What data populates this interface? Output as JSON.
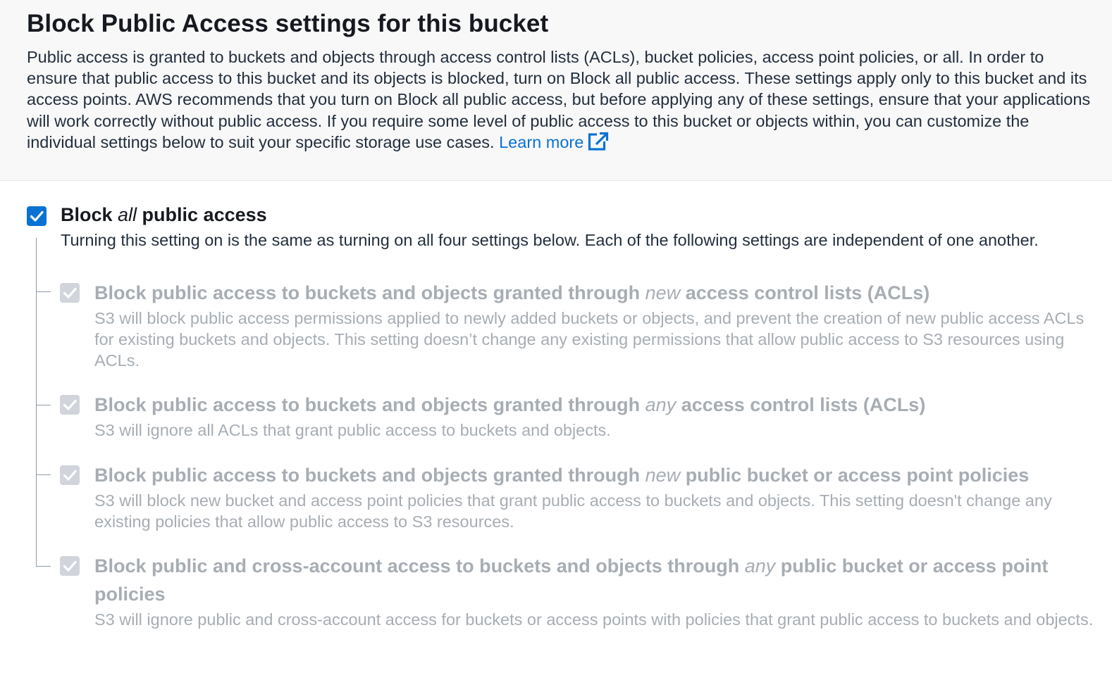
{
  "header": {
    "title": "Block Public Access settings for this bucket",
    "description": "Public access is granted to buckets and objects through access control lists (ACLs), bucket policies, access point policies, or all. In order to ensure that public access to this bucket and its objects is blocked, turn on Block all public access. These settings apply only to this bucket and its access points. AWS recommends that you turn on Block all public access, but before applying any of these settings, ensure that your applications will work correctly without public access. If you require some level of public access to this bucket or objects within, you can customize the individual settings below to suit your specific storage use cases.",
    "learn_more": "Learn more",
    "learn_more_icon": "external-link-icon"
  },
  "block_all": {
    "checked": true,
    "label_before": "Block ",
    "label_em": "all",
    "label_after": " public access",
    "description": "Turning this setting on is the same as turning on all four settings below. Each of the following settings are independent of one another."
  },
  "options": [
    {
      "checked": true,
      "disabled": true,
      "label_before": "Block public access to buckets and objects granted through ",
      "label_em": "new",
      "label_after": " access control lists (ACLs)",
      "description": "S3 will block public access permissions applied to newly added buckets or objects, and prevent the creation of new public access ACLs for existing buckets and objects. This setting doesn’t change any existing permissions that allow public access to S3 resources using ACLs."
    },
    {
      "checked": true,
      "disabled": true,
      "label_before": "Block public access to buckets and objects granted through ",
      "label_em": "any",
      "label_after": " access control lists (ACLs)",
      "description": "S3 will ignore all ACLs that grant public access to buckets and objects."
    },
    {
      "checked": true,
      "disabled": true,
      "label_before": "Block public access to buckets and objects granted through ",
      "label_em": "new",
      "label_after": " public bucket or access point policies",
      "description": "S3 will block new bucket and access point policies that grant public access to buckets and objects. This setting doesn't change any existing policies that allow public access to S3 resources."
    },
    {
      "checked": true,
      "disabled": true,
      "label_before": "Block public and cross-account access to buckets and objects through ",
      "label_em": "any",
      "label_after": " public bucket or access point policies",
      "description": "S3 will ignore public and cross-account access for buckets or access points with policies that grant public access to buckets and objects."
    }
  ],
  "colors": {
    "accent": "#0972d3",
    "disabled_text": "#a7adb3",
    "disabled_checkbox": "#d1d5db",
    "header_bg": "#f8f8f8"
  }
}
